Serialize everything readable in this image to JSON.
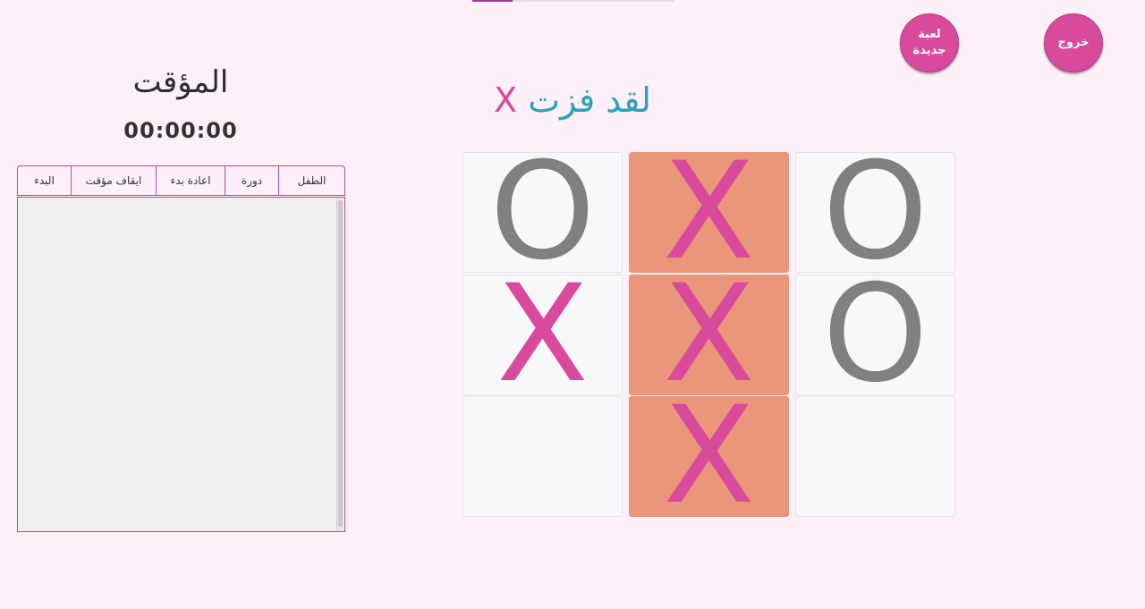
{
  "header": {
    "exit_label": "خروج",
    "new_game_label": "لعبة جديدة",
    "progress": 0.2
  },
  "timer": {
    "title": "المؤقت",
    "value": "00:00:00"
  },
  "tabs": [
    {
      "label": "الطفل"
    },
    {
      "label": "دورة"
    },
    {
      "label": "اعادة بدء"
    },
    {
      "label": "ايقاف مؤقت"
    },
    {
      "label": "البدء"
    }
  ],
  "result": {
    "text": "لقد فزت",
    "player": "X"
  },
  "board": {
    "cells": [
      {
        "mark": "O",
        "win": false
      },
      {
        "mark": "X",
        "win": true
      },
      {
        "mark": "O",
        "win": false
      },
      {
        "mark": "X",
        "win": false
      },
      {
        "mark": "X",
        "win": true
      },
      {
        "mark": "O",
        "win": false
      },
      {
        "mark": "",
        "win": false
      },
      {
        "mark": "X",
        "win": true
      },
      {
        "mark": "",
        "win": false
      }
    ]
  },
  "colors": {
    "accent": "#d94a9c",
    "win_text": "#2ba2b8",
    "win_cell": "#e9967a",
    "o_mark": "#808080",
    "background": "#fdf0f8"
  }
}
